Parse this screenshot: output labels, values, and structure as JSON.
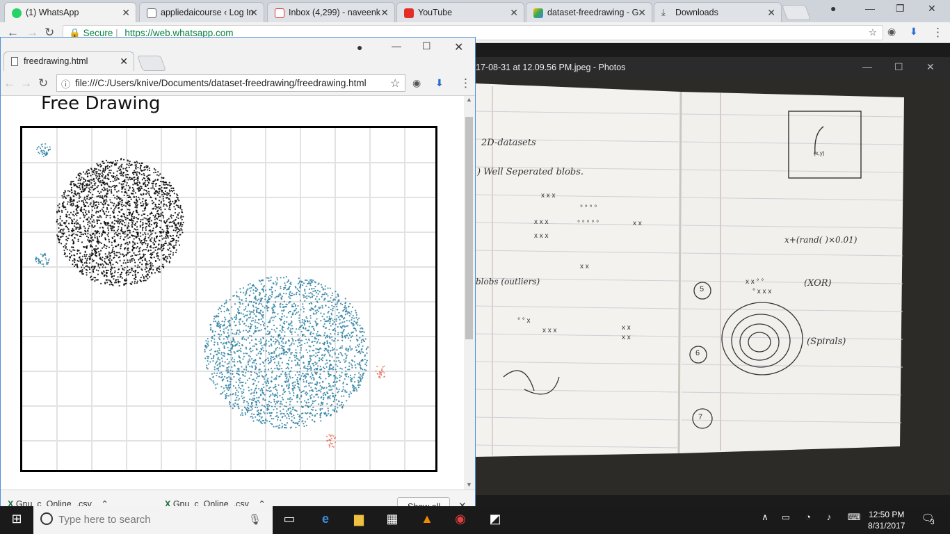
{
  "back_browser": {
    "tabs": [
      {
        "label": "(1) WhatsApp",
        "icon": "whatsapp-icon"
      },
      {
        "label": "appliedaicourse ‹ Log In",
        "icon": "page-icon"
      },
      {
        "label": "Inbox (4,299) - naveenk",
        "icon": "gmail-icon"
      },
      {
        "label": "YouTube",
        "icon": "youtube-icon"
      },
      {
        "label": "dataset-freedrawing - G",
        "icon": "drive-icon"
      },
      {
        "label": "Downloads",
        "icon": "download-icon"
      }
    ],
    "secure_label": "Secure",
    "url": "https://web.whatsapp.com"
  },
  "photos": {
    "title": "17-08-31 at 12.09.56 PM.jpeg - Photos",
    "notes": {
      "heading": "2D-datasets",
      "line1": ") Well Seperated blobs.",
      "outliers": "blobs (outliers)",
      "formula": "x+(rand( )×0.01)",
      "xor": "(XOR)",
      "spirals": "(Spirals)",
      "num5": "5",
      "num6": "6",
      "num7": "7",
      "box_label": "(x,y)"
    }
  },
  "front_browser": {
    "tab_label": "freedrawing.html",
    "url": "file:///C:/Users/knive/Documents/dataset-freedrawing/freedrawing.html",
    "page_title": "Free Drawing",
    "downloads": [
      {
        "label": "Gnu_c_Online_.csv"
      },
      {
        "label": "Gnu_c_Online_.csv"
      }
    ],
    "show_all": "Show all",
    "colors": {
      "black": "#000000",
      "teal": "#2a7fa0",
      "salmon": "#e8705a"
    }
  },
  "taskbar": {
    "search_placeholder": "Type here to search",
    "time": "12:50 PM",
    "date": "8/31/2017",
    "notifications": "3"
  }
}
